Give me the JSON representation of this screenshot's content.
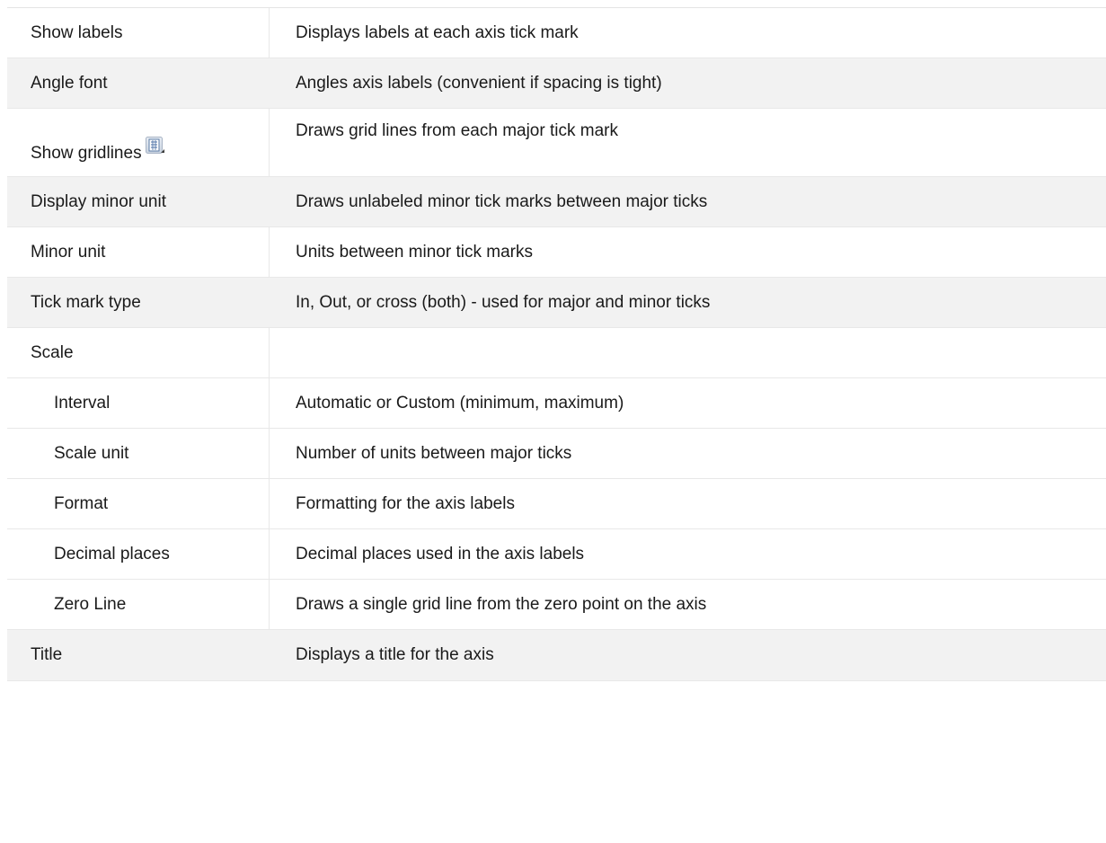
{
  "rows": [
    {
      "name": "Show labels",
      "desc": "Displays labels at each axis tick mark",
      "shaded": false,
      "indent": false
    },
    {
      "name": "Angle font",
      "desc": "Angles axis labels (convenient if spacing is tight)",
      "shaded": true,
      "indent": false
    },
    {
      "name": "Show gridlines",
      "desc": "Draws grid lines from each major tick mark",
      "shaded": false,
      "indent": false,
      "icon": "gridlines-icon"
    },
    {
      "name": "Display minor unit",
      "desc": "Draws unlabeled minor tick marks between major ticks",
      "shaded": true,
      "indent": false
    },
    {
      "name": "Minor unit",
      "desc": "Units between minor tick marks",
      "shaded": false,
      "indent": false
    },
    {
      "name": "Tick mark type",
      "desc": "In, Out, or cross (both) - used for major and minor ticks",
      "shaded": true,
      "indent": false
    },
    {
      "name": "Scale",
      "desc": "",
      "shaded": false,
      "indent": false
    },
    {
      "name": "Interval",
      "desc": "Automatic or Custom (minimum, maximum)",
      "shaded": false,
      "indent": true
    },
    {
      "name": "Scale unit",
      "desc": "Number of units between major ticks",
      "shaded": false,
      "indent": true
    },
    {
      "name": "Format",
      "desc": "Formatting for the axis labels",
      "shaded": false,
      "indent": true
    },
    {
      "name": "Decimal places",
      "desc": "Decimal places used in the axis labels",
      "shaded": false,
      "indent": true
    },
    {
      "name": "Zero Line",
      "desc": "Draws a single grid line from the zero point on the axis",
      "shaded": false,
      "indent": true
    },
    {
      "name": "Title",
      "desc": "Displays a title for the axis",
      "shaded": true,
      "indent": false
    }
  ],
  "colors": {
    "shaded_row": "#f2f2f2",
    "border": "#e8e8e8",
    "text": "#1a1a1a"
  }
}
